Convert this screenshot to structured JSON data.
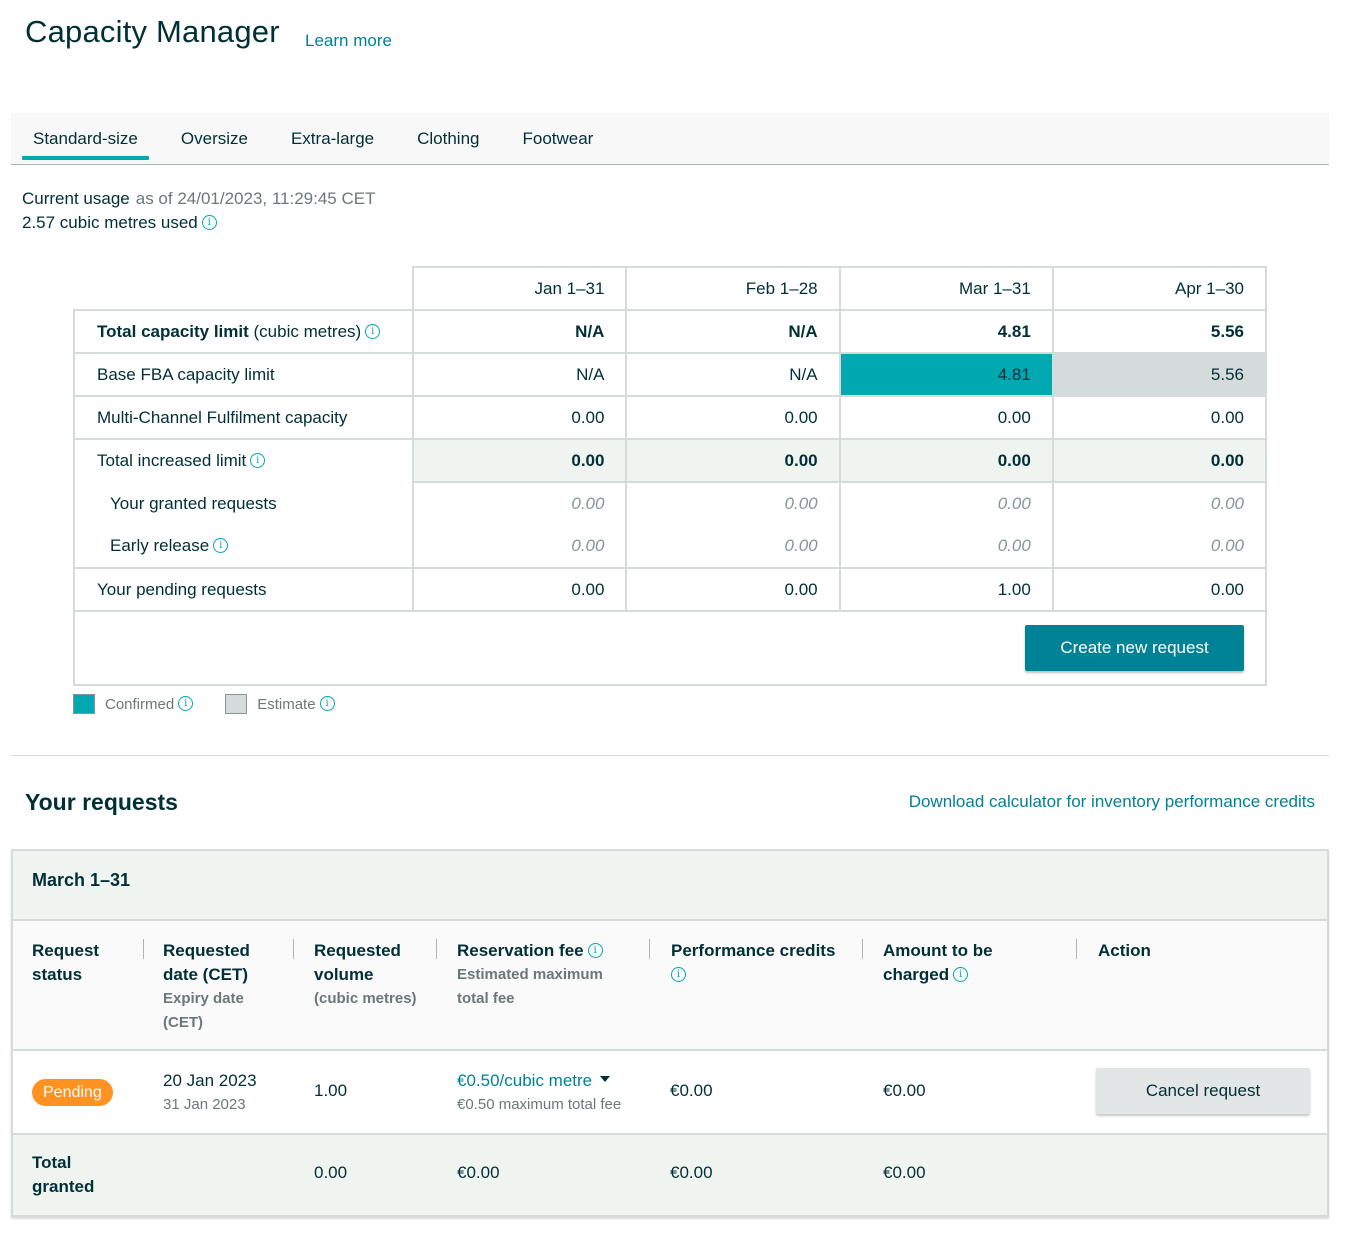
{
  "header": {
    "title": "Capacity Manager",
    "learn_more": "Learn more"
  },
  "tabs": [
    {
      "label": "Standard-size",
      "active": true
    },
    {
      "label": "Oversize",
      "active": false
    },
    {
      "label": "Extra-large",
      "active": false
    },
    {
      "label": "Clothing",
      "active": false
    },
    {
      "label": "Footwear",
      "active": false
    }
  ],
  "usage": {
    "label": "Current usage",
    "as_of": "as of 24/01/2023, 11:29:45 CET",
    "used": "2.57 cubic metres used"
  },
  "capacity_table": {
    "columns": [
      "Jan 1–31",
      "Feb 1–28",
      "Mar 1–31",
      "Apr 1–30"
    ],
    "rows": {
      "total_limit": {
        "label_bold": "Total capacity limit",
        "label_suffix": " (cubic metres)",
        "values": [
          "N/A",
          "N/A",
          "4.81",
          "5.56"
        ]
      },
      "base_fba": {
        "label": "Base FBA capacity limit",
        "values": [
          "N/A",
          "N/A",
          "4.81",
          "5.56"
        ],
        "status": [
          "none",
          "none",
          "confirmed",
          "estimate"
        ]
      },
      "mcf": {
        "label": "Multi-Channel Fulfilment capacity",
        "values": [
          "0.00",
          "0.00",
          "0.00",
          "0.00"
        ]
      },
      "increased": {
        "label": "Total increased limit",
        "values": [
          "0.00",
          "0.00",
          "0.00",
          "0.00"
        ]
      },
      "granted": {
        "label": "Your granted requests",
        "values": [
          "0.00",
          "0.00",
          "0.00",
          "0.00"
        ]
      },
      "early_release": {
        "label": "Early release",
        "values": [
          "0.00",
          "0.00",
          "0.00",
          "0.00"
        ]
      },
      "pending": {
        "label": "Your pending requests",
        "values": [
          "0.00",
          "0.00",
          "1.00",
          "0.00"
        ]
      }
    },
    "create_button": "Create new request"
  },
  "legend": {
    "confirmed": {
      "label": "Confirmed",
      "color": "#00a8b2"
    },
    "estimate": {
      "label": "Estimate",
      "color": "#d5dbdb"
    }
  },
  "requests": {
    "title": "Your requests",
    "download_link": "Download calculator for inventory performance credits",
    "period": "March 1–31",
    "headers": {
      "status": "Request status",
      "date": "Requested date (CET)",
      "date_sub": "Expiry date (CET)",
      "volume": "Requested volume",
      "volume_sub": "(cubic metres)",
      "fee": "Reservation fee",
      "fee_sub": "Estimated maximum total fee",
      "credits": "Performance credits",
      "amount": "Amount to be charged",
      "action": "Action"
    },
    "rows": [
      {
        "status": "Pending",
        "status_color": "#ff9220",
        "requested_date": "20 Jan 2023",
        "expiry_date": "31 Jan 2023",
        "volume": "1.00",
        "fee": "€0.50/cubic metre",
        "fee_total": "€0.50 maximum total fee",
        "credits": "€0.00",
        "amount": "€0.00",
        "action": "Cancel request"
      }
    ],
    "total": {
      "label": "Total granted",
      "volume": "0.00",
      "fee": "€0.00",
      "credits": "€0.00",
      "amount": "€0.00"
    }
  },
  "colors": {
    "accent": "#008296",
    "tab_indicator": "#00a8b2",
    "pending": "#ff9220"
  }
}
